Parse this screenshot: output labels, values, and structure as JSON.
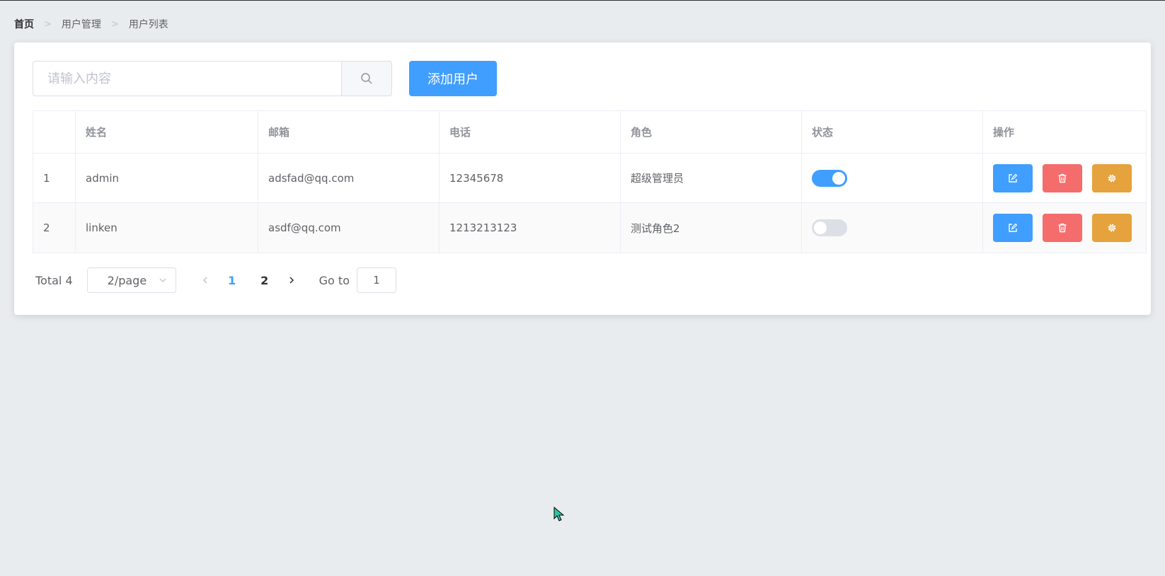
{
  "breadcrumb": [
    "首页",
    "用户管理",
    "用户列表"
  ],
  "search": {
    "placeholder": "请输入内容",
    "value": ""
  },
  "add_button": "添加用户",
  "table": {
    "headers": [
      "",
      "姓名",
      "邮箱",
      "电话",
      "角色",
      "状态",
      "操作"
    ],
    "rows": [
      {
        "index": "1",
        "name": "admin",
        "email": "adsfad@qq.com",
        "phone": "12345678",
        "role": "超级管理员",
        "status": true
      },
      {
        "index": "2",
        "name": "linken",
        "email": "asdf@qq.com",
        "phone": "1213213123",
        "role": "测试角色2",
        "status": false
      }
    ]
  },
  "pagination": {
    "total": "Total 4",
    "page_size": "2/page",
    "pages": [
      "1",
      "2"
    ],
    "current_page": "1",
    "goto_label": "Go to",
    "goto_value": "1"
  },
  "colors": {
    "primary": "#409eff",
    "danger": "#f56c6c",
    "warning": "#e6a23c",
    "background": "#e9ecef"
  },
  "icons": {
    "search": "search-icon",
    "edit": "edit-icon",
    "delete": "delete-icon",
    "settings": "gear-icon",
    "breadcrumb_separator": "chevron-right-icon",
    "select": "chevron-down-icon",
    "prev": "chevron-left-icon",
    "next": "chevron-right-icon"
  }
}
